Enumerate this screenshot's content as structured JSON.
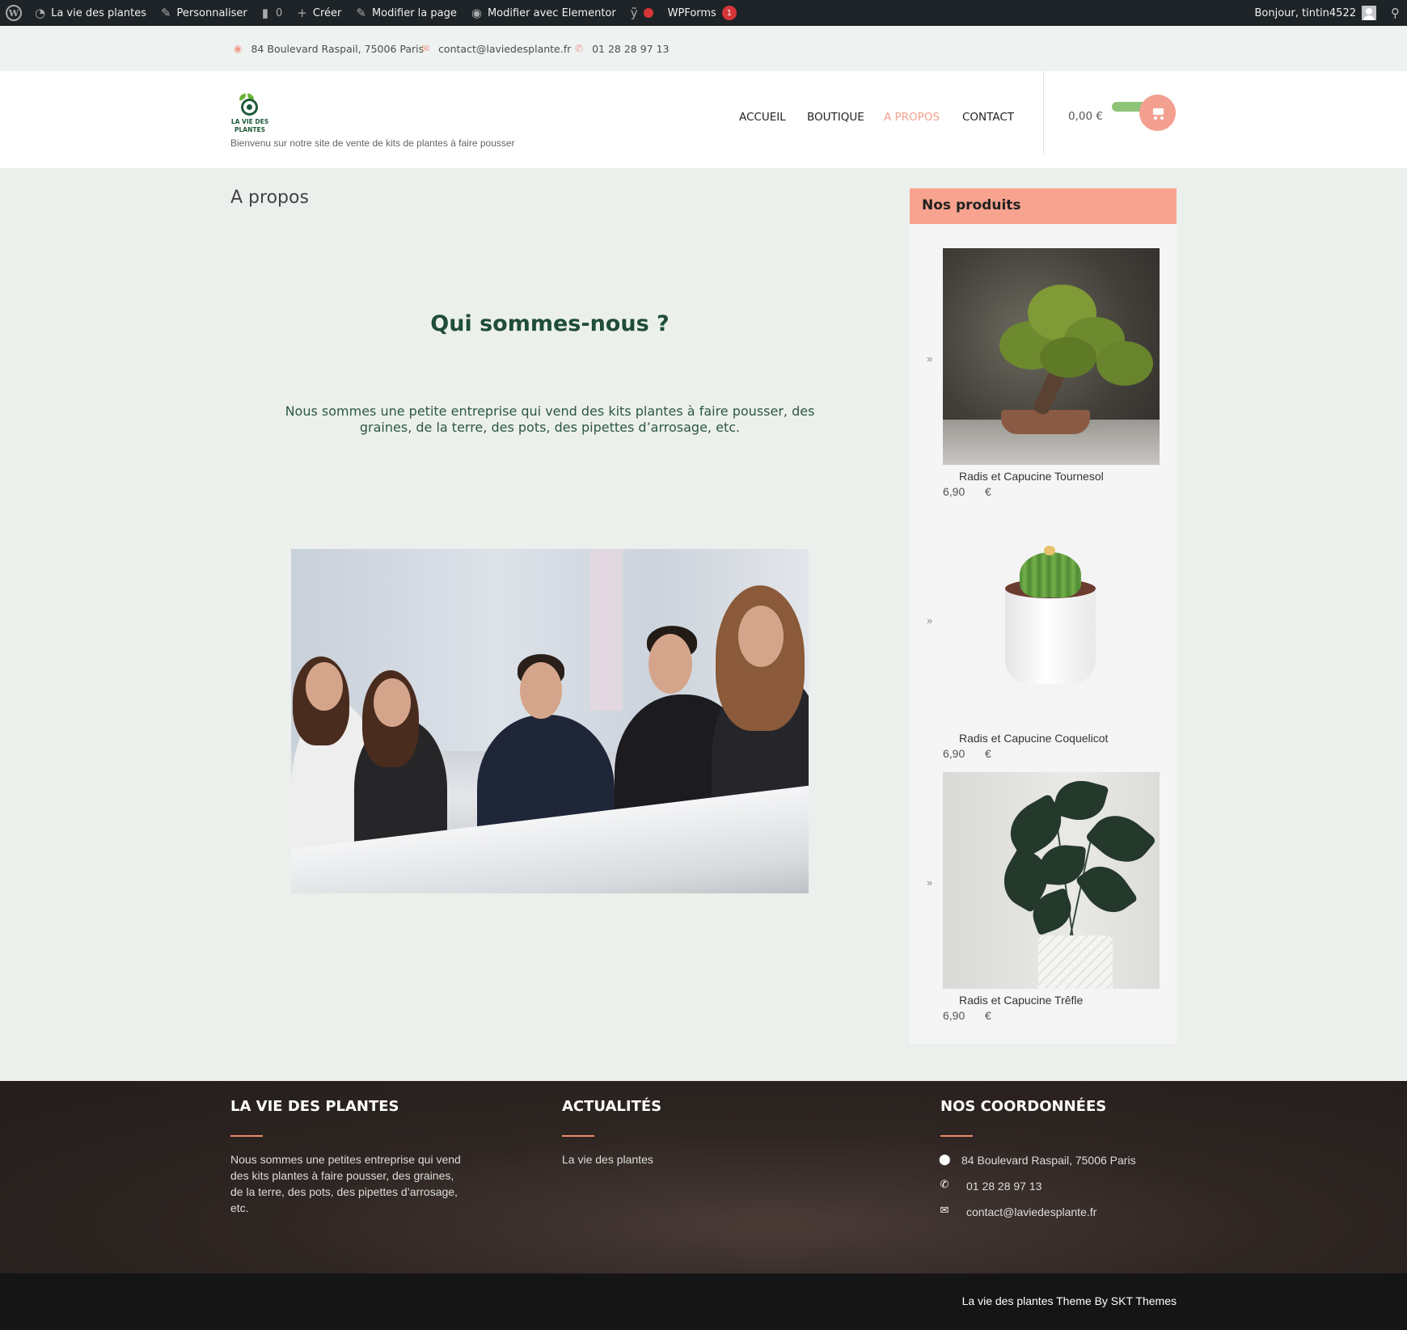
{
  "admin_bar": {
    "site_name": "La vie des plantes",
    "customize": "Personnaliser",
    "comments_count": "0",
    "new": "Créer",
    "edit_page": "Modifier la page",
    "edit_elementor": "Modifier avec Elementor",
    "wpforms": "WPForms",
    "wpforms_count": "1",
    "greeting": "Bonjour, tintin4522"
  },
  "topbar": {
    "address": "84 Boulevard Raspail, 75006 Paris",
    "email": "contact@laviedesplante.fr",
    "phone": "01 28 28 97 13"
  },
  "header": {
    "logo_text": "LA VIE DES PLANTES",
    "tagline": "Bienvenu sur notre site de vente de kits de plantes à faire pousser",
    "nav": [
      "ACCUEIL",
      "BOUTIQUE",
      "A PROPOS",
      "CONTACT"
    ],
    "active_nav": "A PROPOS",
    "cart_total": "0,00 €"
  },
  "main": {
    "page_title": "A propos",
    "heading": "Qui sommes-nous ?",
    "intro": "Nous sommes une petite entreprise qui vend des kits plantes à faire pousser, des graines, de la terre, des pots, des pipettes d’arrosage, etc."
  },
  "sidebar": {
    "title": "Nos produits",
    "products": [
      {
        "name": "Radis et Capucine Tournesol",
        "price": "6,90",
        "currency": "€",
        "image": "bonsai"
      },
      {
        "name": "Radis et Capucine Coquelicot",
        "price": "6,90",
        "currency": "€",
        "image": "cactus"
      },
      {
        "name": "Radis et Capucine Trêfle",
        "price": "6,90",
        "currency": "€",
        "image": "monstera-plant"
      }
    ]
  },
  "footer": {
    "col1_title": "LA VIE DES PLANTES",
    "col1_text": "Nous sommes une petites entreprise qui vend des kits plantes à faire pousser, des graines, de la terre, des pots, des pipettes d’arrosage, etc.",
    "col2_title": "ACTUALITÉS",
    "col2_link": "La vie des plantes",
    "col3_title": "NOS COORDONNÉES",
    "address": "84 Boulevard Raspail, 75006 Paris",
    "phone": "01 28 28 97 13",
    "email": "contact@laviedesplante.fr",
    "credit": "La vie des plantes Theme By SKT Themes"
  },
  "colors": {
    "accent": "#f8a38f",
    "heading_green": "#1f4d3a",
    "admin_bar": "#1d2327",
    "footer_bg": "#2f2623"
  }
}
